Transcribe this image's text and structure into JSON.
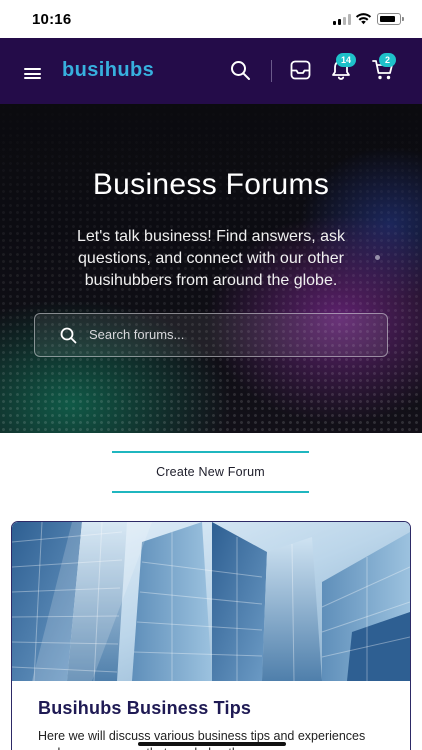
{
  "status_bar": {
    "time": "10:16"
  },
  "header": {
    "logo": "busihubs",
    "notifications_count": "14",
    "cart_count": "2",
    "icons": [
      "menu-icon",
      "search-icon",
      "inbox-icon",
      "bell-icon",
      "cart-icon"
    ]
  },
  "hero": {
    "title": "Business Forums",
    "subtitle": "Let's talk business! Find answers, ask questions, and connect with our other busihubbers from around the globe.",
    "search_placeholder": "Search forums..."
  },
  "actions": {
    "create_forum_label": "Create New Forum"
  },
  "forums": [
    {
      "title": "Busihubs Business Tips",
      "description": "Here we will discuss various business tips and experiences we have overcome that can help others"
    }
  ],
  "colors": {
    "header_bg": "#240c49",
    "logo": "#37b0de",
    "accent_teal": "#1fb6bf",
    "badge": "#1ec1c9",
    "card_title": "#1f1a54",
    "card_border": "#2d2a66"
  }
}
